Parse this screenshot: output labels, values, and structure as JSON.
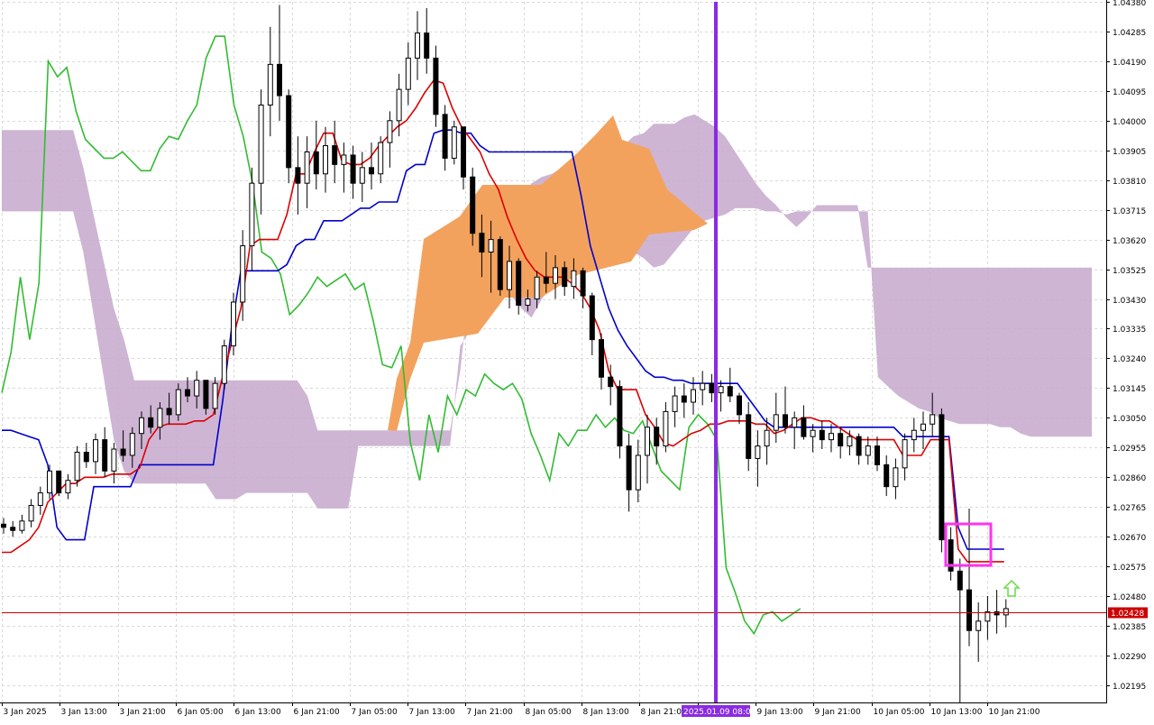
{
  "colors": {
    "background": "#ffffff",
    "grid": "#d9d9d9",
    "axis": "#000000",
    "bull_candle": "#ffffff",
    "bear_candle": "#000000",
    "kijun": "#0000cc",
    "tenkan": "#dd0000",
    "chikou": "#33bb33",
    "kumo_bear": "#c6a8cc",
    "kumo_bull": "#f3a25e",
    "current_price": "#cc0000",
    "marker_line": "#8a2be2",
    "highlight_box": "#ff33ee",
    "arrow": "#66dd44"
  },
  "price_label": "1.02428",
  "marker_label": "2025.01.09 08:00",
  "chart_data": {
    "type": "candlestick",
    "ylim": [
      1.0214,
      1.0438
    ],
    "grid": true,
    "y_ticks": [
      "1.04380",
      "1.04285",
      "1.04190",
      "1.04095",
      "1.04000",
      "1.03905",
      "1.03810",
      "1.03715",
      "1.03620",
      "1.03525",
      "1.03430",
      "1.03335",
      "1.03240",
      "1.03145",
      "1.03050",
      "1.02955",
      "1.02860",
      "1.02765",
      "1.02670",
      "1.02575",
      "1.02480",
      "1.02385",
      "1.02290",
      "1.02195"
    ],
    "x_ticks": [
      "3 Jan 2025",
      "3 Jan 13:00",
      "3 Jan 21:00",
      "6 Jan 05:00",
      "6 Jan 13:00",
      "6 Jan 21:00",
      "7 Jan 05:00",
      "7 Jan 13:00",
      "7 Jan 21:00",
      "8 Jan 05:00",
      "8 Jan 13:00",
      "8 Jan 21:00",
      "2025.01.09 08:00",
      "9 Jan 13:00",
      "9 Jan 21:00",
      "10 Jan 05:00",
      "10 Jan 13:00",
      "10 Jan 21:00"
    ],
    "current_price": 1.02428,
    "ohlc": [
      [
        1.0271,
        1.0273,
        1.0268,
        1.027
      ],
      [
        1.027,
        1.0272,
        1.0267,
        1.0269
      ],
      [
        1.0269,
        1.0274,
        1.0268,
        1.0272
      ],
      [
        1.0272,
        1.0279,
        1.027,
        1.0277
      ],
      [
        1.0277,
        1.0283,
        1.0274,
        1.0281
      ],
      [
        1.0281,
        1.029,
        1.0279,
        1.0288
      ],
      [
        1.0288,
        1.0286,
        1.028,
        1.0281
      ],
      [
        1.0281,
        1.0287,
        1.0279,
        1.0285
      ],
      [
        1.0285,
        1.0296,
        1.0283,
        1.0294
      ],
      [
        1.0294,
        1.0297,
        1.0289,
        1.0291
      ],
      [
        1.0291,
        1.03,
        1.0287,
        1.0298
      ],
      [
        1.0298,
        1.0302,
        1.0286,
        1.0288
      ],
      [
        1.0288,
        1.0297,
        1.0284,
        1.0295
      ],
      [
        1.0295,
        1.0301,
        1.0291,
        1.0293
      ],
      [
        1.0293,
        1.0302,
        1.0289,
        1.03
      ],
      [
        1.03,
        1.0307,
        1.0295,
        1.0305
      ],
      [
        1.0305,
        1.0309,
        1.03,
        1.0302
      ],
      [
        1.0302,
        1.031,
        1.0298,
        1.0308
      ],
      [
        1.0308,
        1.0313,
        1.0303,
        1.0306
      ],
      [
        1.0306,
        1.0316,
        1.0304,
        1.0314
      ],
      [
        1.0314,
        1.0318,
        1.031,
        1.0312
      ],
      [
        1.0312,
        1.032,
        1.0308,
        1.0317
      ],
      [
        1.0317,
        1.0314,
        1.0306,
        1.0308
      ],
      [
        1.0308,
        1.0318,
        1.0306,
        1.0316
      ],
      [
        1.0316,
        1.033,
        1.0314,
        1.0328
      ],
      [
        1.0328,
        1.0345,
        1.0325,
        1.0342
      ],
      [
        1.0342,
        1.0365,
        1.0336,
        1.036
      ],
      [
        1.036,
        1.0385,
        1.0352,
        1.038
      ],
      [
        1.038,
        1.041,
        1.037,
        1.0405
      ],
      [
        1.0405,
        1.043,
        1.0395,
        1.0418
      ],
      [
        1.0418,
        1.0437,
        1.04,
        1.0408
      ],
      [
        1.0408,
        1.041,
        1.038,
        1.0385
      ],
      [
        1.0385,
        1.0395,
        1.037,
        1.038
      ],
      [
        1.038,
        1.0395,
        1.0372,
        1.039
      ],
      [
        1.039,
        1.04,
        1.0378,
        1.0383
      ],
      [
        1.0383,
        1.0398,
        1.0377,
        1.0392
      ],
      [
        1.0392,
        1.04,
        1.038,
        1.0386
      ],
      [
        1.0386,
        1.0393,
        1.0377,
        1.0389
      ],
      [
        1.0389,
        1.0392,
        1.0375,
        1.038
      ],
      [
        1.038,
        1.039,
        1.0374,
        1.0385
      ],
      [
        1.0385,
        1.0393,
        1.0378,
        1.0383
      ],
      [
        1.0383,
        1.0395,
        1.038,
        1.0393
      ],
      [
        1.0393,
        1.0403,
        1.0385,
        1.04
      ],
      [
        1.04,
        1.0415,
        1.0395,
        1.041
      ],
      [
        1.041,
        1.0425,
        1.0405,
        1.042
      ],
      [
        1.042,
        1.0435,
        1.0413,
        1.0428
      ],
      [
        1.0428,
        1.0436,
        1.0415,
        1.042
      ],
      [
        1.042,
        1.0424,
        1.0398,
        1.0402
      ],
      [
        1.0402,
        1.0405,
        1.0384,
        1.0388
      ],
      [
        1.0388,
        1.04,
        1.0386,
        1.0398
      ],
      [
        1.0398,
        1.0397,
        1.0378,
        1.0382
      ],
      [
        1.0382,
        1.0385,
        1.036,
        1.0364
      ],
      [
        1.0364,
        1.037,
        1.035,
        1.0358
      ],
      [
        1.0358,
        1.0368,
        1.0345,
        1.0362
      ],
      [
        1.0362,
        1.0363,
        1.0344,
        1.0346
      ],
      [
        1.0346,
        1.036,
        1.034,
        1.0355
      ],
      [
        1.0355,
        1.0356,
        1.0338,
        1.0341
      ],
      [
        1.0341,
        1.0346,
        1.0339,
        1.0343
      ],
      [
        1.0343,
        1.0352,
        1.034,
        1.035
      ],
      [
        1.035,
        1.0358,
        1.0345,
        1.0348
      ],
      [
        1.0348,
        1.0357,
        1.0343,
        1.0353
      ],
      [
        1.0353,
        1.0355,
        1.0344,
        1.0347
      ],
      [
        1.0347,
        1.0356,
        1.0343,
        1.0352
      ],
      [
        1.0352,
        1.0353,
        1.034,
        1.0344
      ],
      [
        1.0344,
        1.0345,
        1.0325,
        1.033
      ],
      [
        1.033,
        1.0332,
        1.0314,
        1.0318
      ],
      [
        1.0318,
        1.0322,
        1.0309,
        1.0315
      ],
      [
        1.0315,
        1.0317,
        1.0292,
        1.0296
      ],
      [
        1.0296,
        1.03,
        1.0275,
        1.0282
      ],
      [
        1.0282,
        1.0298,
        1.0278,
        1.0293
      ],
      [
        1.0293,
        1.0306,
        1.0284,
        1.0302
      ],
      [
        1.0302,
        1.0305,
        1.029,
        1.0296
      ],
      [
        1.0296,
        1.031,
        1.0294,
        1.0307
      ],
      [
        1.0307,
        1.0315,
        1.0302,
        1.0312
      ],
      [
        1.0312,
        1.0316,
        1.0305,
        1.031
      ],
      [
        1.031,
        1.0318,
        1.0306,
        1.0314
      ],
      [
        1.0314,
        1.032,
        1.0309,
        1.0316
      ],
      [
        1.0316,
        1.0319,
        1.031,
        1.0313
      ],
      [
        1.0313,
        1.0317,
        1.0307,
        1.0315
      ],
      [
        1.0315,
        1.0321,
        1.031,
        1.0312
      ],
      [
        1.0312,
        1.0313,
        1.0303,
        1.0306
      ],
      [
        1.0306,
        1.031,
        1.0288,
        1.0292
      ],
      [
        1.0292,
        1.0301,
        1.0283,
        1.0296
      ],
      [
        1.0296,
        1.0305,
        1.029,
        1.0301
      ],
      [
        1.0301,
        1.0313,
        1.0297,
        1.0306
      ],
      [
        1.0306,
        1.0315,
        1.03,
        1.0302
      ],
      [
        1.0302,
        1.0307,
        1.0295,
        1.0305
      ],
      [
        1.0305,
        1.0309,
        1.0298,
        1.0299
      ],
      [
        1.0299,
        1.0303,
        1.0294,
        1.0301
      ],
      [
        1.0301,
        1.0304,
        1.0295,
        1.0298
      ],
      [
        1.0298,
        1.0303,
        1.0294,
        1.03
      ],
      [
        1.03,
        1.0302,
        1.0292,
        1.0296
      ],
      [
        1.0296,
        1.0301,
        1.0293,
        1.0299
      ],
      [
        1.0299,
        1.03,
        1.029,
        1.0293
      ],
      [
        1.0293,
        1.0299,
        1.029,
        1.0296
      ],
      [
        1.0296,
        1.0299,
        1.0288,
        1.029
      ],
      [
        1.029,
        1.0293,
        1.028,
        1.0283
      ],
      [
        1.0283,
        1.0292,
        1.0279,
        1.0289
      ],
      [
        1.0289,
        1.03,
        1.0285,
        1.0298
      ],
      [
        1.0298,
        1.0305,
        1.0294,
        1.0301
      ],
      [
        1.0301,
        1.0307,
        1.0295,
        1.0303
      ],
      [
        1.0303,
        1.0313,
        1.0299,
        1.0306
      ],
      [
        1.0306,
        1.0308,
        1.0262,
        1.0266
      ],
      [
        1.0266,
        1.027,
        1.0253,
        1.0256
      ],
      [
        1.0256,
        1.026,
        1.0214,
        1.025
      ],
      [
        1.025,
        1.0276,
        1.0232,
        1.0237
      ],
      [
        1.0237,
        1.0246,
        1.0227,
        1.024
      ],
      [
        1.024,
        1.0248,
        1.0234,
        1.0243
      ],
      [
        1.0243,
        1.025,
        1.0236,
        1.0242
      ],
      [
        1.0242,
        1.0247,
        1.0238,
        1.0244
      ]
    ],
    "kijun": [
      1.0301,
      1.0301,
      1.03,
      1.0299,
      1.0298,
      1.029,
      1.027,
      1.0266,
      1.0266,
      1.0266,
      1.0283,
      1.0283,
      1.0283,
      1.0283,
      1.0283,
      1.029,
      1.029,
      1.029,
      1.029,
      1.029,
      1.029,
      1.029,
      1.029,
      1.029,
      1.031,
      1.0334,
      1.0352,
      1.0352,
      1.0352,
      1.0352,
      1.0352,
      1.0354,
      1.036,
      1.0362,
      1.0362,
      1.0368,
      1.0368,
      1.0368,
      1.037,
      1.0372,
      1.0372,
      1.0374,
      1.0374,
      1.0374,
      1.0384,
      1.0386,
      1.0386,
      1.0396,
      1.0397,
      1.0397,
      1.0396,
      1.0396,
      1.0392,
      1.039,
      1.039,
      1.039,
      1.039,
      1.039,
      1.039,
      1.039,
      1.039,
      1.039,
      1.039,
      1.0376,
      1.036,
      1.035,
      1.034,
      1.0333,
      1.0328,
      1.0324,
      1.032,
      1.0318,
      1.0318,
      1.0317,
      1.0317,
      1.0316,
      1.0316,
      1.0316,
      1.0316,
      1.0316,
      1.0316,
      1.0312,
      1.0308,
      1.0304,
      1.0302,
      1.0302,
      1.0302,
      1.0302,
      1.0302,
      1.0302,
      1.0302,
      1.0302,
      1.0302,
      1.0302,
      1.0302,
      1.0302,
      1.0302,
      1.0302,
      1.0299,
      1.0299,
      1.0299,
      1.0299,
      1.0299,
      1.0299,
      1.027,
      1.0263,
      1.0263,
      1.0263,
      1.0263,
      1.0263
    ],
    "tenkan": [
      1.0262,
      1.0262,
      1.0264,
      1.0266,
      1.027,
      1.0278,
      1.0281,
      1.0284,
      1.0284,
      1.0286,
      1.0286,
      1.0286,
      1.0287,
      1.0287,
      1.0287,
      1.0289,
      1.0298,
      1.0302,
      1.0303,
      1.0303,
      1.0303,
      1.0304,
      1.0304,
      1.0306,
      1.0318,
      1.0329,
      1.034,
      1.036,
      1.0362,
      1.0362,
      1.0362,
      1.037,
      1.0383,
      1.0383,
      1.039,
      1.0396,
      1.0396,
      1.0387,
      1.0386,
      1.0386,
      1.0388,
      1.0392,
      1.0395,
      1.0398,
      1.04,
      1.0404,
      1.0409,
      1.0413,
      1.0412,
      1.0404,
      1.0398,
      1.0394,
      1.039,
      1.0383,
      1.0378,
      1.0369,
      1.0362,
      1.0356,
      1.0352,
      1.035,
      1.035,
      1.035,
      1.0348,
      1.0345,
      1.034,
      1.0333,
      1.032,
      1.0314,
      1.0314,
      1.0314,
      1.0306,
      1.0302,
      1.0297,
      1.0296,
      1.0298,
      1.03,
      1.0301,
      1.0303,
      1.0303,
      1.0304,
      1.0304,
      1.0304,
      1.0303,
      1.0303,
      1.03,
      1.0301,
      1.0303,
      1.0305,
      1.0305,
      1.0304,
      1.0304,
      1.0302,
      1.03,
      1.0298,
      1.0298,
      1.0298,
      1.0298,
      1.0298,
      1.0293,
      1.0293,
      1.0293,
      1.0298,
      1.0298,
      1.0298,
      1.0263,
      1.0259,
      1.0259,
      1.0259,
      1.0259,
      1.0259
    ],
    "chikou": [
      1.0313,
      1.0326,
      1.035,
      1.033,
      1.0348,
      1.0419,
      1.0414,
      1.0417,
      1.0403,
      1.0394,
      1.0391,
      1.0388,
      1.0388,
      1.039,
      1.0387,
      1.0384,
      1.0384,
      1.0391,
      1.0395,
      1.0394,
      1.04,
      1.0405,
      1.042,
      1.0427,
      1.0427,
      1.0405,
      1.0395,
      1.038,
      1.0358,
      1.0356,
      1.0351,
      1.0338,
      1.0341,
      1.0345,
      1.035,
      1.0347,
      1.0349,
      1.0351,
      1.0346,
      1.0348,
      1.0336,
      1.0322,
      1.0321,
      1.0328,
      1.0297,
      1.0285,
      1.0306,
      1.0294,
      1.0312,
      1.0306,
      1.0314,
      1.0312,
      1.0319,
      1.0316,
      1.0314,
      1.0316,
      1.0311,
      1.03,
      1.0293,
      1.0285,
      1.03,
      1.0296,
      1.0301,
      1.0301,
      1.0306,
      1.0302,
      1.0305,
      1.0301,
      1.03,
      1.0304,
      1.0296,
      1.0288,
      1.0285,
      1.0282,
      1.0302,
      1.0306,
      1.0303,
      1.0298,
      1.0257,
      1.0249,
      1.024,
      1.0236,
      1.0242,
      1.0243,
      1.024,
      1.0242,
      1.0244
    ],
    "span_a": [
      1.0373,
      1.0373,
      1.0373,
      1.0373,
      1.0373,
      1.0373,
      1.0373,
      1.0373,
      1.0373,
      1.0373,
      1.0373,
      1.0373,
      1.0373,
      1.0373,
      1.0373,
      1.0373,
      1.0373,
      1.0373,
      1.0373,
      1.0373,
      1.0373,
      1.0373,
      1.0373,
      1.0373,
      1.0373,
      1.0373,
      1.0373,
      1.0373,
      1.0373,
      1.0373,
      1.0373,
      1.0373,
      1.0373,
      1.0373,
      1.0373,
      1.0373,
      1.0373,
      1.0373,
      1.0373,
      1.0373,
      1.0373,
      1.0373,
      1.0373,
      1.0373,
      1.0373,
      1.0373,
      1.0373,
      1.0373,
      1.0373,
      1.0373,
      1.0373,
      1.0373,
      1.0373,
      1.0373,
      1.0373,
      1.0373,
      1.0373,
      1.0373,
      1.0373,
      1.0373,
      1.0373,
      1.0373,
      1.0373,
      1.0373,
      1.0373,
      1.0373,
      1.0373,
      1.0373,
      1.0373,
      1.0373,
      1.0373,
      1.0373,
      1.0373,
      1.0373,
      1.0373,
      1.0373,
      1.0373,
      1.0373,
      1.0373,
      1.0373,
      1.0373,
      1.0373,
      1.0373,
      1.0373,
      1.0373,
      1.0373,
      1.0373,
      1.0373,
      1.0373,
      1.0373,
      1.0373,
      1.0373,
      1.0373,
      1.0373,
      1.0373,
      1.0373,
      1.0373,
      1.0373,
      1.0373,
      1.0373,
      1.0373,
      1.0373,
      1.0373,
      1.0373,
      1.0373,
      1.0373,
      1.0373,
      1.0373,
      1.0373
    ],
    "cloud_upper": [
      1.0397,
      1.0397,
      1.0397,
      1.0397,
      1.0397,
      1.0397,
      1.0397,
      1.0397,
      1.0385,
      1.037,
      1.0355,
      1.034,
      1.033,
      1.0317,
      1.0317,
      1.0317,
      1.0317,
      1.0317,
      1.0317,
      1.0317,
      1.0317,
      1.0317,
      1.0317,
      1.0317,
      1.0317,
      1.0317,
      1.0317,
      1.0317,
      1.0317,
      1.0317,
      1.0312,
      1.0301,
      1.0301,
      1.0301,
      1.0301,
      1.0301,
      1.0301,
      1.0301,
      1.0301,
      1.0301,
      1.0301,
      1.0301,
      1.0301,
      1.0301,
      1.0301,
      1.032,
      1.035,
      1.0362,
      1.0366,
      1.037,
      1.0372,
      1.0375,
      1.038,
      1.0382,
      1.0383,
      1.0385,
      1.0386,
      1.0388,
      1.0388,
      1.0389,
      1.039,
      1.0392,
      1.0395,
      1.0396,
      1.0399,
      1.0399,
      1.0399,
      1.0401,
      1.0402,
      1.04,
      1.0398,
      1.0395,
      1.039,
      1.0385,
      1.038,
      1.0376,
      1.0373,
      1.0369,
      1.0366,
      1.0369,
      1.0373,
      1.0373,
      1.0373,
      1.0373,
      1.0373,
      1.0353,
      1.0353,
      1.0353,
      1.0353,
      1.0353,
      1.0353,
      1.0353,
      1.0353,
      1.0353,
      1.0353,
      1.0353,
      1.0353,
      1.0353,
      1.0353,
      1.0353,
      1.0353,
      1.0353,
      1.0353,
      1.0353,
      1.0353,
      1.0353,
      1.0353,
      1.0353
    ],
    "cloud_lower": [
      1.0371,
      1.0371,
      1.0371,
      1.0371,
      1.0371,
      1.0371,
      1.0371,
      1.0371,
      1.0358,
      1.0338,
      1.0318,
      1.0298,
      1.0288,
      1.0284,
      1.0284,
      1.0284,
      1.0284,
      1.0284,
      1.0284,
      1.0284,
      1.0284,
      1.0279,
      1.0279,
      1.0279,
      1.0281,
      1.0281,
      1.0281,
      1.0281,
      1.0281,
      1.0281,
      1.0281,
      1.0276,
      1.0276,
      1.0276,
      1.0276,
      1.0296,
      1.0296,
      1.0296,
      1.0296,
      1.0296,
      1.0296,
      1.0296,
      1.0296,
      1.0296,
      1.0296,
      1.0328,
      1.0333,
      1.0333,
      1.034,
      1.0344,
      1.0344,
      1.034,
      1.0337,
      1.0343,
      1.0347,
      1.035,
      1.0353,
      1.0353,
      1.0355,
      1.0356,
      1.0358,
      1.0358,
      1.0358,
      1.0356,
      1.0353,
      1.0354,
      1.0358,
      1.0362,
      1.0366,
      1.0368,
      1.0369,
      1.037,
      1.0372,
      1.0372,
      1.0372,
      1.0371,
      1.0371,
      1.037,
      1.0371,
      1.0371,
      1.0371,
      1.0371,
      1.0371,
      1.0371,
      1.0371,
      1.0371,
      1.0318,
      1.0315,
      1.0312,
      1.031,
      1.0308,
      1.0307,
      1.0305,
      1.0304,
      1.0303,
      1.0303,
      1.0303,
      1.0303,
      1.0302,
      1.0302,
      1.03,
      1.0299,
      1.0299,
      1.0299,
      1.0299,
      1.0299,
      1.0299,
      1.0299
    ]
  }
}
